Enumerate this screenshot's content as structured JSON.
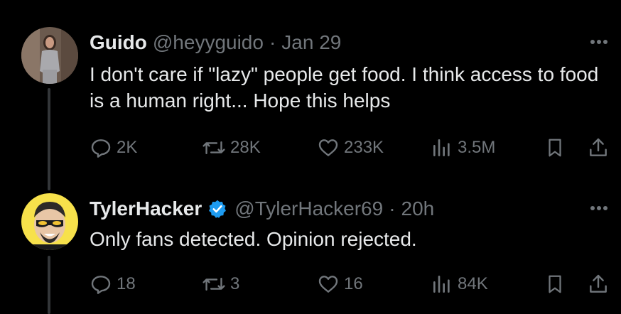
{
  "tweets": [
    {
      "author_name": "Guido",
      "handle": "@heyyguido",
      "separator": "·",
      "time": "Jan 29",
      "verified": false,
      "text": "I don't care if \"lazy\" people get food. I think access to food is a human right... Hope this helps",
      "replies": "2K",
      "retweets": "28K",
      "likes": "233K",
      "views": "3.5M"
    },
    {
      "author_name": "TylerHacker",
      "handle": "@TylerHacker69",
      "separator": "·",
      "time": "20h",
      "verified": true,
      "text": "Only fans detected. Opinion rejected.",
      "replies": "18",
      "retweets": "3",
      "likes": "16",
      "views": "84K"
    }
  ],
  "colors": {
    "background": "#000000",
    "primary_text": "#e7e9ea",
    "secondary_text": "#71767b",
    "verified_badge": "#1d9bf0",
    "avatar2_background": "#f7e14b"
  },
  "icons": [
    "more-icon",
    "reply-icon",
    "retweet-icon",
    "like-icon",
    "views-icon",
    "bookmark-icon",
    "share-icon",
    "verified-badge-icon"
  ]
}
